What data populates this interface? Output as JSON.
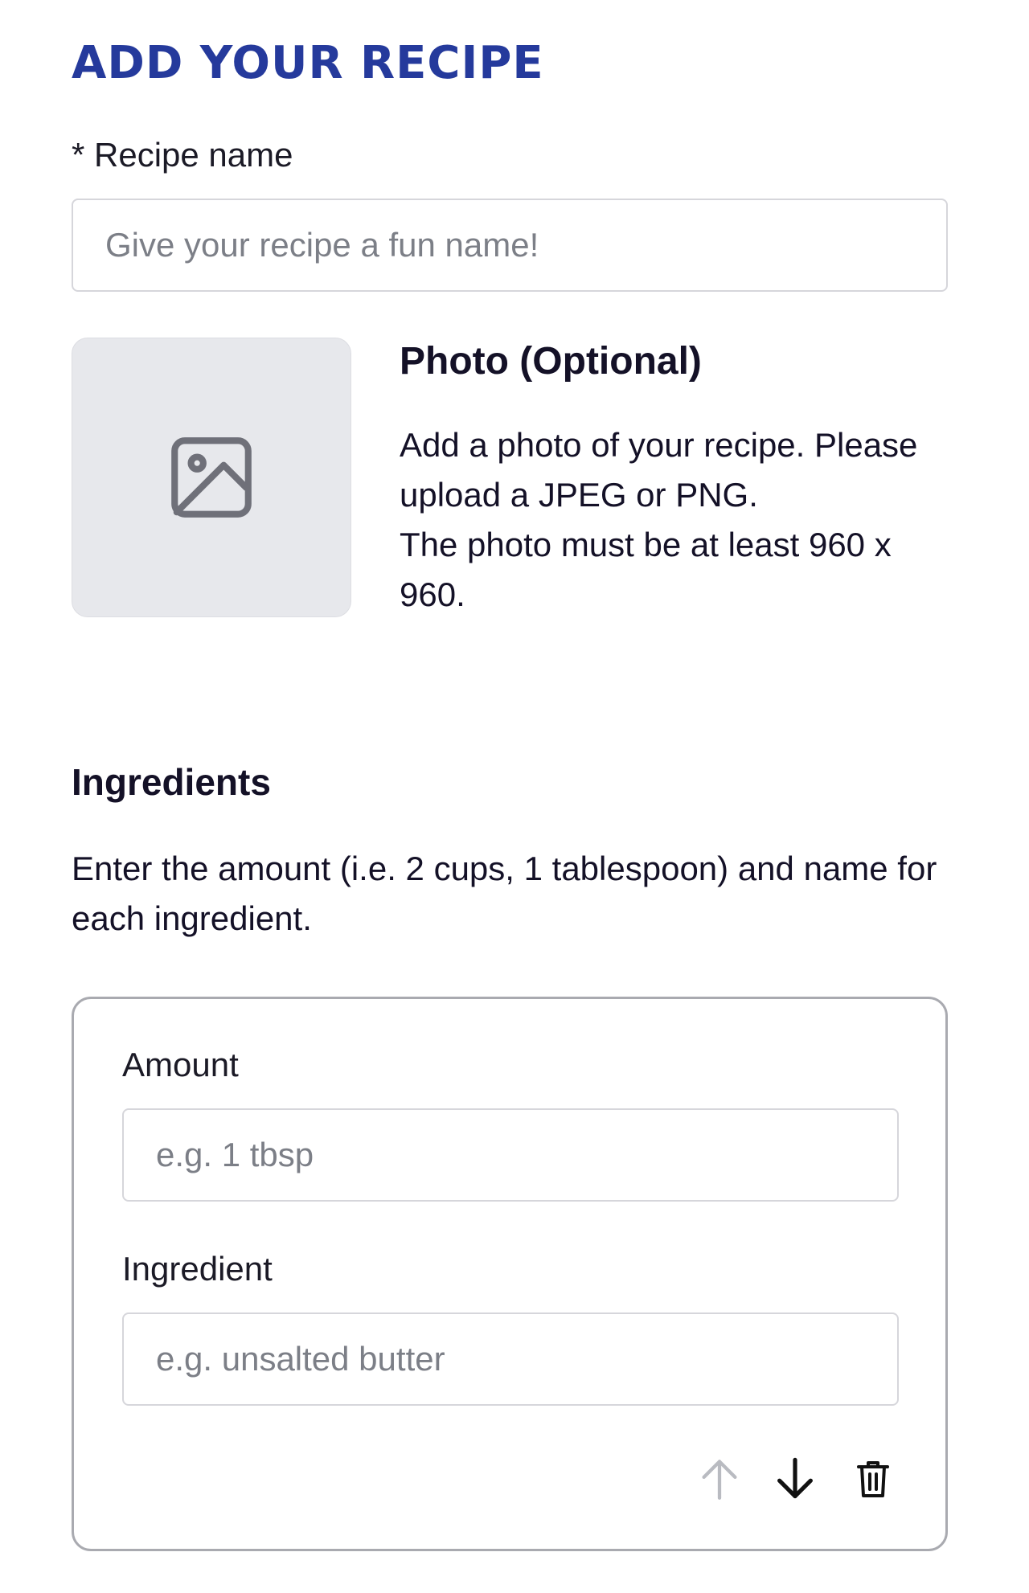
{
  "header": {
    "title": "ADD YOUR RECIPE",
    "title_color": "#253a9c"
  },
  "recipe_name": {
    "label": "* Recipe name",
    "placeholder": "Give your recipe a fun name!",
    "value": ""
  },
  "photo": {
    "icon": "image-icon",
    "title": "Photo (Optional)",
    "description_lines": [
      "Add a photo of your recipe. Please upload a JPEG or PNG.",
      "The photo must be at least 960 x 960."
    ]
  },
  "ingredients": {
    "title": "Ingredients",
    "description": "Enter the amount (i.e. 2 cups, 1 tablespoon) and name for each ingredient.",
    "items": [
      {
        "amount_label": "Amount",
        "amount_placeholder": "e.g. 1 tbsp",
        "amount_value": "",
        "ingredient_label": "Ingredient",
        "ingredient_placeholder": "e.g. unsalted butter",
        "ingredient_value": "",
        "actions": {
          "move_up": {
            "icon": "arrow-up-icon",
            "enabled": false
          },
          "move_down": {
            "icon": "arrow-down-icon",
            "enabled": true
          },
          "delete": {
            "icon": "trash-icon",
            "enabled": true
          }
        }
      }
    ]
  }
}
